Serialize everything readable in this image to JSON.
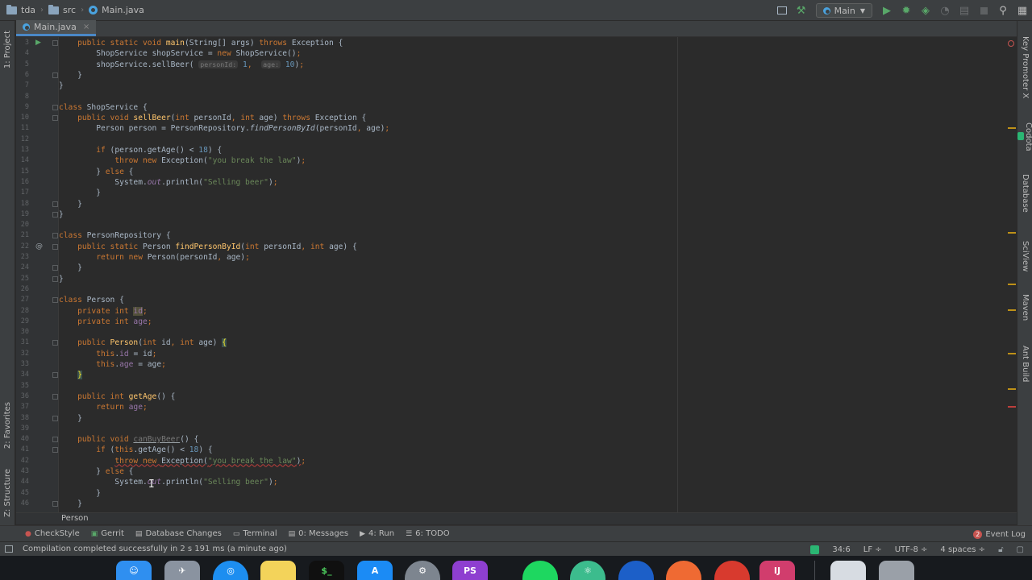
{
  "breadcrumbs": [
    "tda",
    "src",
    "Main.java"
  ],
  "run_config": "Main",
  "editor_tab": {
    "label": "Main.java",
    "close": "×"
  },
  "left_tabs": [
    "1: Project",
    "2: Favorites",
    "Z: Structure"
  ],
  "right_tabs": [
    "Key Promoter X",
    "Codota",
    "Database",
    "SciView",
    "Maven",
    "Ant Build"
  ],
  "code_lines": [
    {
      "n": "3",
      "tokens": [
        [
          "    ",
          ""
        ],
        [
          "public static void ",
          "kw"
        ],
        [
          "main",
          "fn"
        ],
        [
          "(String[] args) ",
          ""
        ],
        [
          "throws ",
          "kw"
        ],
        [
          "Exception {",
          ""
        ]
      ]
    },
    {
      "n": "4",
      "tokens": [
        [
          "        ShopService shopService = ",
          ""
        ],
        [
          "new ",
          "kw"
        ],
        [
          "ShopService()",
          ""
        ],
        [
          ";",
          "kw"
        ]
      ]
    },
    {
      "n": "5",
      "tokens": [
        [
          "        shopService.sellBeer( ",
          ""
        ],
        [
          "personId:",
          "hint"
        ],
        [
          " ",
          ""
        ],
        [
          "1",
          "num"
        ],
        [
          ",  ",
          "kw"
        ],
        [
          "age:",
          "hint"
        ],
        [
          " ",
          ""
        ],
        [
          "10",
          "num"
        ],
        [
          ")",
          ""
        ],
        [
          ";",
          "kw"
        ]
      ]
    },
    {
      "n": "6",
      "tokens": [
        [
          "    }",
          ""
        ]
      ]
    },
    {
      "n": "7",
      "tokens": [
        [
          "}",
          ""
        ]
      ]
    },
    {
      "n": "8",
      "tokens": []
    },
    {
      "n": "9",
      "tokens": [
        [
          "class ",
          "kw"
        ],
        [
          "ShopService {",
          ""
        ]
      ]
    },
    {
      "n": "10",
      "tokens": [
        [
          "    ",
          ""
        ],
        [
          "public void ",
          "kw"
        ],
        [
          "sellBeer",
          "fn"
        ],
        [
          "(",
          ""
        ],
        [
          "int ",
          "kw"
        ],
        [
          "personId",
          ""
        ],
        [
          ", ",
          "kw"
        ],
        [
          "int ",
          "kw"
        ],
        [
          "age) ",
          ""
        ],
        [
          "throws ",
          "kw"
        ],
        [
          "Exception {",
          ""
        ]
      ]
    },
    {
      "n": "11",
      "tokens": [
        [
          "        Person person = PersonRepository.",
          ""
        ],
        [
          "findPersonById",
          "static"
        ],
        [
          "(personId",
          ""
        ],
        [
          ", ",
          "kw"
        ],
        [
          "age)",
          ""
        ],
        [
          ";",
          "kw"
        ]
      ]
    },
    {
      "n": "12",
      "tokens": []
    },
    {
      "n": "13",
      "tokens": [
        [
          "        ",
          ""
        ],
        [
          "if ",
          "kw"
        ],
        [
          "(person.getAge() < ",
          ""
        ],
        [
          "18",
          "num"
        ],
        [
          ") {",
          ""
        ]
      ]
    },
    {
      "n": "14",
      "tokens": [
        [
          "            ",
          ""
        ],
        [
          "throw new ",
          "kw"
        ],
        [
          "Exception(",
          ""
        ],
        [
          "\"you break the law\"",
          "str"
        ],
        [
          ")",
          ""
        ],
        [
          ";",
          "kw"
        ]
      ]
    },
    {
      "n": "15",
      "tokens": [
        [
          "        } ",
          ""
        ],
        [
          "else ",
          "kw"
        ],
        [
          "{",
          ""
        ]
      ]
    },
    {
      "n": "16",
      "tokens": [
        [
          "            System.",
          ""
        ],
        [
          "out",
          "sfld"
        ],
        [
          ".println(",
          ""
        ],
        [
          "\"Selling beer\"",
          "str"
        ],
        [
          ")",
          ""
        ],
        [
          ";",
          "kw"
        ]
      ]
    },
    {
      "n": "17",
      "tokens": [
        [
          "        }",
          ""
        ]
      ]
    },
    {
      "n": "18",
      "tokens": [
        [
          "    }",
          ""
        ]
      ]
    },
    {
      "n": "19",
      "tokens": [
        [
          "}",
          ""
        ]
      ]
    },
    {
      "n": "20",
      "tokens": []
    },
    {
      "n": "21",
      "tokens": [
        [
          "class ",
          "kw"
        ],
        [
          "PersonRepository {",
          ""
        ]
      ]
    },
    {
      "n": "22",
      "tokens": [
        [
          "    ",
          ""
        ],
        [
          "public static ",
          "kw"
        ],
        [
          "Person ",
          ""
        ],
        [
          "findPersonById",
          "fn"
        ],
        [
          "(",
          ""
        ],
        [
          "int ",
          "kw"
        ],
        [
          "personId",
          ""
        ],
        [
          ", ",
          "kw"
        ],
        [
          "int ",
          "kw"
        ],
        [
          "age) {",
          ""
        ]
      ]
    },
    {
      "n": "23",
      "tokens": [
        [
          "        ",
          ""
        ],
        [
          "return new ",
          "kw"
        ],
        [
          "Person(personId",
          ""
        ],
        [
          ", ",
          "kw"
        ],
        [
          "age)",
          ""
        ],
        [
          ";",
          "kw"
        ]
      ]
    },
    {
      "n": "24",
      "tokens": [
        [
          "    }",
          ""
        ]
      ]
    },
    {
      "n": "25",
      "tokens": [
        [
          "}",
          ""
        ]
      ]
    },
    {
      "n": "26",
      "tokens": []
    },
    {
      "n": "27",
      "tokens": [
        [
          "class ",
          "kw"
        ],
        [
          "Person {",
          ""
        ]
      ]
    },
    {
      "n": "28",
      "tokens": [
        [
          "    ",
          ""
        ],
        [
          "private int ",
          "kw"
        ],
        [
          "id",
          "warnfld"
        ],
        [
          ";",
          "kw"
        ]
      ]
    },
    {
      "n": "29",
      "tokens": [
        [
          "    ",
          ""
        ],
        [
          "private int ",
          "kw"
        ],
        [
          "age",
          "fld"
        ],
        [
          ";",
          "kw"
        ]
      ]
    },
    {
      "n": "30",
      "tokens": []
    },
    {
      "n": "31",
      "tokens": [
        [
          "    ",
          ""
        ],
        [
          "public ",
          "kw"
        ],
        [
          "Person",
          "fn"
        ],
        [
          "(",
          ""
        ],
        [
          "int ",
          "kw"
        ],
        [
          "id",
          ""
        ],
        [
          ", ",
          "kw"
        ],
        [
          "int ",
          "kw"
        ],
        [
          "age) ",
          ""
        ],
        [
          "{",
          "brace"
        ]
      ]
    },
    {
      "n": "32",
      "tokens": [
        [
          "        ",
          ""
        ],
        [
          "this",
          "kw"
        ],
        [
          ".",
          ""
        ],
        [
          "id",
          "fld"
        ],
        [
          " = id",
          ""
        ],
        [
          ";",
          "kw"
        ]
      ]
    },
    {
      "n": "33",
      "tokens": [
        [
          "        ",
          ""
        ],
        [
          "this",
          "kw"
        ],
        [
          ".",
          ""
        ],
        [
          "age",
          "fld"
        ],
        [
          " = age",
          ""
        ],
        [
          ";",
          "kw"
        ]
      ]
    },
    {
      "n": "34",
      "tokens": [
        [
          "    ",
          ""
        ],
        [
          "}",
          "brace"
        ]
      ]
    },
    {
      "n": "35",
      "tokens": []
    },
    {
      "n": "36",
      "tokens": [
        [
          "    ",
          ""
        ],
        [
          "public int ",
          "kw"
        ],
        [
          "getAge",
          "fn"
        ],
        [
          "() {",
          ""
        ]
      ]
    },
    {
      "n": "37",
      "tokens": [
        [
          "        ",
          ""
        ],
        [
          "return ",
          "kw"
        ],
        [
          "age",
          "fld"
        ],
        [
          ";",
          "kw"
        ]
      ]
    },
    {
      "n": "38",
      "tokens": [
        [
          "    }",
          ""
        ]
      ]
    },
    {
      "n": "39",
      "tokens": []
    },
    {
      "n": "40",
      "tokens": [
        [
          "    ",
          ""
        ],
        [
          "public void ",
          "kw"
        ],
        [
          "canBuyBeer",
          "unused"
        ],
        [
          "() {",
          ""
        ]
      ]
    },
    {
      "n": "41",
      "tokens": [
        [
          "        ",
          ""
        ],
        [
          "if ",
          "kw"
        ],
        [
          "(",
          ""
        ],
        [
          "this",
          "kw"
        ],
        [
          ".getAge() < ",
          ""
        ],
        [
          "18",
          "num"
        ],
        [
          ") {",
          ""
        ]
      ]
    },
    {
      "n": "42",
      "tokens": [
        [
          "            ",
          ""
        ],
        [
          "throw new ",
          "kwerr"
        ],
        [
          "Exception(",
          "err"
        ],
        [
          "\"you break the law\"",
          "strerr"
        ],
        [
          ")",
          "err"
        ],
        [
          ";",
          "kw"
        ]
      ]
    },
    {
      "n": "43",
      "tokens": [
        [
          "        } ",
          ""
        ],
        [
          "else ",
          "kw"
        ],
        [
          "{",
          ""
        ]
      ]
    },
    {
      "n": "44",
      "tokens": [
        [
          "            System.",
          ""
        ],
        [
          "out",
          "sfld"
        ],
        [
          ".println(",
          ""
        ],
        [
          "\"Selling beer\"",
          "str"
        ],
        [
          ")",
          ""
        ],
        [
          ";",
          "kw"
        ]
      ]
    },
    {
      "n": "45",
      "tokens": [
        [
          "        }",
          ""
        ]
      ]
    },
    {
      "n": "46",
      "tokens": [
        [
          "    }",
          ""
        ]
      ]
    }
  ],
  "editor_breadcrumb": "Person",
  "bottom_tools": [
    {
      "label": "CheckStyle",
      "icon": "checkstyle-icon"
    },
    {
      "label": "Gerrit",
      "icon": "gerrit-icon"
    },
    {
      "label": "Database Changes",
      "icon": "database-changes-icon"
    },
    {
      "label": "Terminal",
      "icon": "terminal-icon"
    },
    {
      "label": "0: Messages",
      "icon": "messages-icon"
    },
    {
      "label": "4: Run",
      "icon": "run-icon"
    },
    {
      "label": "6: TODO",
      "icon": "todo-icon"
    }
  ],
  "event_log": {
    "label": "Event Log",
    "count": "2"
  },
  "status": {
    "message": "Compilation completed successfully in 2 s 191 ms (a minute ago)",
    "position": "34:6",
    "line_sep": "LF ÷",
    "encoding": "UTF-8 ÷",
    "indent": "4 spaces ÷"
  },
  "dock": {
    "phpstorm": "PS"
  },
  "colors": {
    "keyword": "#cc7832",
    "function": "#ffc66d",
    "string": "#6a8759",
    "number": "#6897bb",
    "field": "#9876aa",
    "accent": "#4a88c7"
  }
}
